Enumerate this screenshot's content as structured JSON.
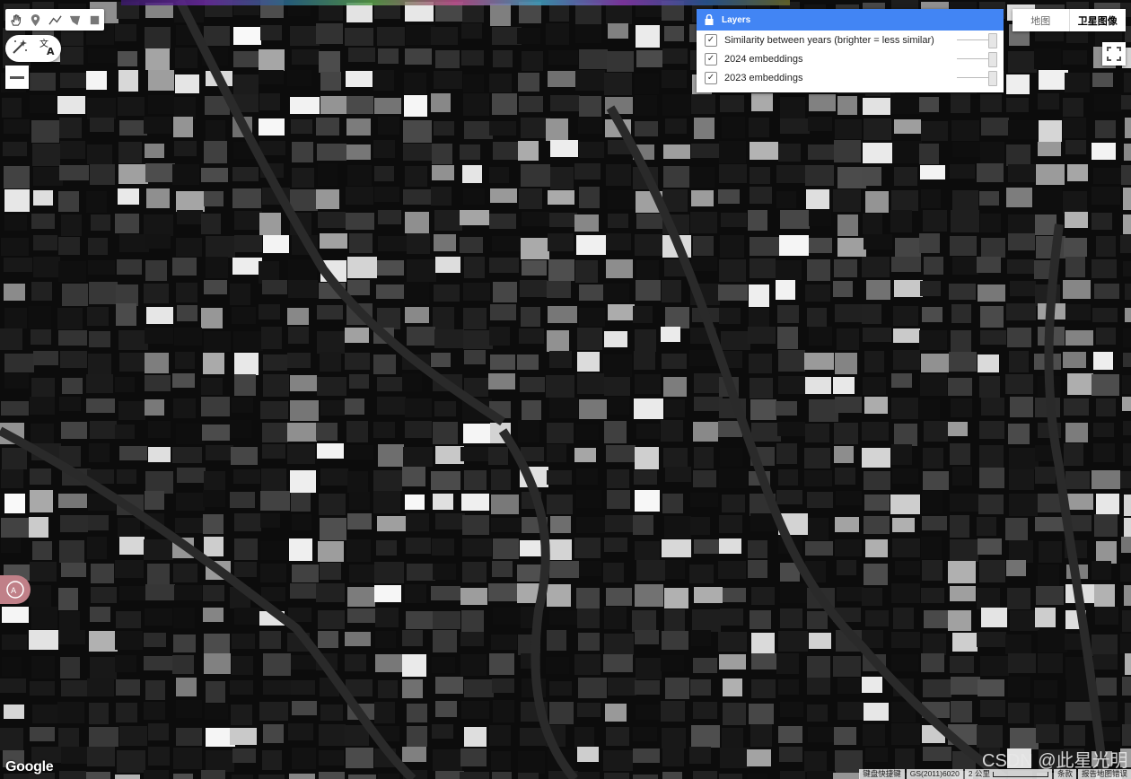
{
  "toolbar": {
    "tools": [
      "hand-icon",
      "marker-icon",
      "line-icon",
      "polygon-icon",
      "rectangle-icon"
    ]
  },
  "controls": {
    "magic_icon": "magic-wand-icon",
    "translate_icon": "translate-icon",
    "zoom_out_icon": "minus-icon",
    "fullscreen_icon": "fullscreen-icon"
  },
  "layers_panel": {
    "title": "Layers",
    "items": [
      {
        "label": "Similarity between years (brighter = less similar)",
        "checked": true,
        "opacity": 1.0
      },
      {
        "label": "2024 embeddings",
        "checked": true,
        "opacity": 1.0
      },
      {
        "label": "2023 embeddings",
        "checked": true,
        "opacity": 1.0
      }
    ]
  },
  "map_type": {
    "map_label": "地图",
    "satellite_label": "卫星图像"
  },
  "footer": {
    "google_logo": "Google",
    "watermark": "CSDN @此星光明",
    "shortcuts": "键盘快捷键",
    "data_attrib": "GS(2011)6020",
    "scale_label": "2 公里",
    "terms": "条款",
    "report": "报告地图错误"
  },
  "colors": {
    "accent": "#4285f4",
    "map_bg": "#0c0c0c"
  }
}
